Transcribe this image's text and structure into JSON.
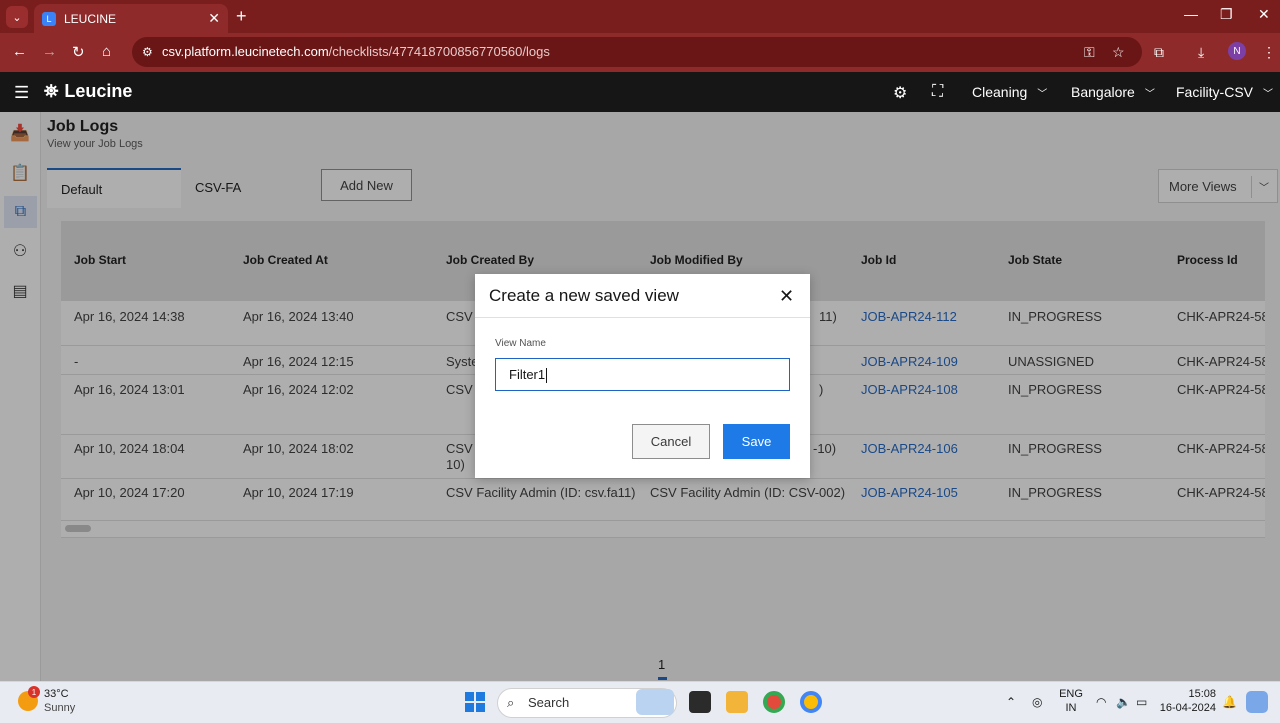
{
  "browser": {
    "tab_title": "LEUCINE",
    "url_host": "csv.platform.leucinetech.com",
    "url_path": "/checklists/477418700856770560/logs",
    "profile_initial": "N"
  },
  "app": {
    "brand": "Leucine",
    "header": {
      "use_case": "Cleaning",
      "location": "Bangalore",
      "facility": "Facility-CSV"
    }
  },
  "page": {
    "title": "Job Logs",
    "subtitle": "View your Job Logs",
    "views": [
      {
        "label": "Default"
      },
      {
        "label": "CSV-FA"
      }
    ],
    "add_new_label": "Add New",
    "more_views_label": "More Views"
  },
  "table": {
    "columns": [
      "Job Start",
      "Job Created At",
      "Job Created By",
      "Job Modified By",
      "Job Id",
      "Job State",
      "Process Id"
    ],
    "rows": [
      {
        "job_start": "Apr 16, 2024 14:38",
        "created_at": "Apr 16, 2024 13:40",
        "created_by": "CSV F",
        "modified_by": "11)",
        "job_id": "JOB-APR24-112",
        "state": "IN_PROGRESS",
        "process_id": "CHK-APR24-58"
      },
      {
        "job_start": "-",
        "created_at": "Apr 16, 2024 12:15",
        "created_by": "Syste",
        "modified_by": "",
        "job_id": "JOB-APR24-109",
        "state": "UNASSIGNED",
        "process_id": "CHK-APR24-58"
      },
      {
        "job_start": "Apr 16, 2024 13:01",
        "created_at": "Apr 16, 2024 12:02",
        "created_by": "CSV F",
        "modified_by": ")",
        "job_id": "JOB-APR24-108",
        "state": "IN_PROGRESS",
        "process_id": "CHK-APR24-58"
      },
      {
        "job_start": "Apr 10, 2024 18:04",
        "created_at": "Apr 10, 2024 18:02",
        "created_by": "CSV F",
        "created_by_2": "10)",
        "modified_by": "-10)",
        "job_id": "JOB-APR24-106",
        "state": "IN_PROGRESS",
        "process_id": "CHK-APR24-58"
      },
      {
        "job_start": "Apr 10, 2024 17:20",
        "created_at": "Apr 10, 2024 17:19",
        "created_by": "CSV Facility Admin (ID: csv.fa11)",
        "modified_by": "CSV Facility Admin (ID: CSV-002)",
        "job_id": "JOB-APR24-105",
        "state": "IN_PROGRESS",
        "process_id": "CHK-APR24-58"
      }
    ]
  },
  "pagination": {
    "current_page": "1"
  },
  "modal": {
    "title": "Create a new saved view",
    "field_label": "View Name",
    "field_value": "Filter1",
    "cancel_label": "Cancel",
    "save_label": "Save"
  },
  "taskbar": {
    "temperature": "33°C",
    "weather": "Sunny",
    "weather_badge": "1",
    "search_label": "Search",
    "lang_line1": "ENG",
    "lang_line2": "IN",
    "time": "15:08",
    "date": "16-04-2024"
  },
  "colors": {
    "browser_chrome": "#8e2a2a",
    "app_header": "#161616",
    "accent": "#1d64c5",
    "save_button": "#1d7ae6"
  },
  "icons": {
    "rail": [
      "inbox-icon",
      "checklist-icon",
      "job-logs-icon",
      "hierarchy-icon",
      "device-icon"
    ],
    "header": [
      "settings-icon",
      "scan-icon"
    ]
  }
}
